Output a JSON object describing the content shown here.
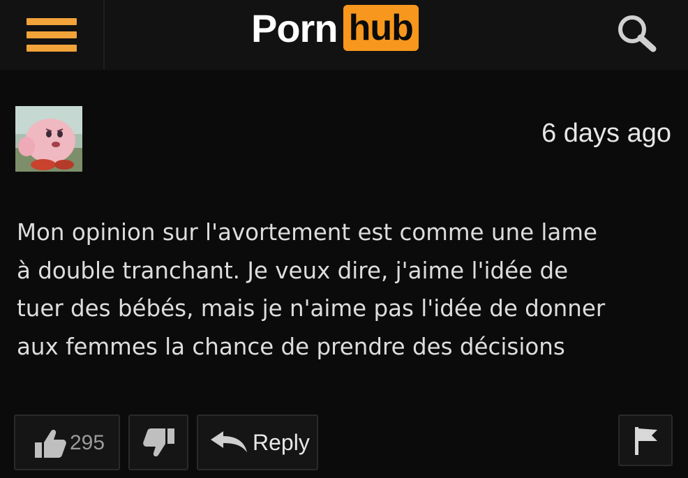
{
  "header": {
    "logo_text_porn": "Porn",
    "logo_text_hub": "hub",
    "menu_icon": "hamburger-menu-icon",
    "search_icon": "search-icon",
    "colors": {
      "accent": "#f7971d",
      "background": "#121212"
    }
  },
  "comment": {
    "avatar": "kirby-avatar",
    "timestamp": "6 days ago",
    "lines": [
      "Mon opinion sur l'avortement est comme une lame",
      "à double tranchant. Je veux dire, j'aime l'idée de",
      "tuer des bébés, mais je n'aime pas l'idée de donner",
      "aux femmes la chance de prendre des décisions"
    ]
  },
  "actions": {
    "like_count": "295",
    "reply_label": "Reply",
    "like_icon": "thumbs-up-icon",
    "dislike_icon": "thumbs-down-icon",
    "reply_icon": "reply-arrow-icon",
    "flag_icon": "flag-icon"
  }
}
